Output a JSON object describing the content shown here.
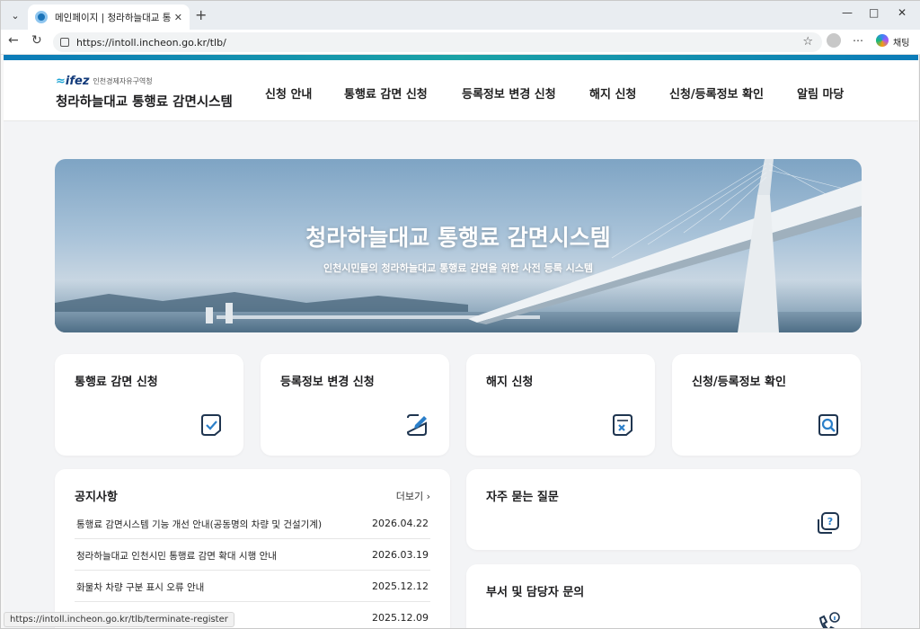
{
  "browser": {
    "tab_title": "메인페이지 | 청라하늘대교 통행료",
    "url": "https://intoll.incheon.go.kr/tlb/",
    "copilot_label": "채팅",
    "status_url": "https://intoll.incheon.go.kr/tlb/terminate-register"
  },
  "header": {
    "logo_mark": "ifez",
    "logo_sub": "인천경제자유구역청",
    "site_title": "청라하늘대교 통행료 감면시스템",
    "nav": [
      "신청 안내",
      "통행료 감면 신청",
      "등록정보 변경 신청",
      "해지 신청",
      "신청/등록정보 확인",
      "알림 마당"
    ]
  },
  "hero": {
    "title": "청라하늘대교 통행료 감면시스템",
    "subtitle": "인천시민들의 청라하늘대교 통행료 감면을 위한 사전 등록 시스템"
  },
  "quick_cards": [
    {
      "label": "통행료 감면 신청",
      "icon": "check-doc-icon"
    },
    {
      "label": "등록정보 변경 신청",
      "icon": "edit-icon"
    },
    {
      "label": "해지 신청",
      "icon": "cancel-doc-icon"
    },
    {
      "label": "신청/등록정보 확인",
      "icon": "search-doc-icon"
    }
  ],
  "notice": {
    "title": "공지사항",
    "more": "더보기",
    "items": [
      {
        "text": "통행료 감면시스템 기능 개선 안내(공동명의 차량 및 건설기계)",
        "date": "2026.04.22"
      },
      {
        "text": "청라하늘대교 인천시민 통행료 감면 확대 시행 안내",
        "date": "2026.03.19"
      },
      {
        "text": "화물차 차량 구분 표시 오류 안내",
        "date": "2025.12.12"
      },
      {
        "text": "",
        "date": "2025.12.09"
      }
    ]
  },
  "side_cards": [
    {
      "label": "자주 묻는 질문",
      "icon": "faq-icon"
    },
    {
      "label": "부서 및 담당자 문의",
      "icon": "phone-info-icon"
    }
  ],
  "colors": {
    "accent": "#1a4f87",
    "stripe": "#0b7bb8"
  }
}
